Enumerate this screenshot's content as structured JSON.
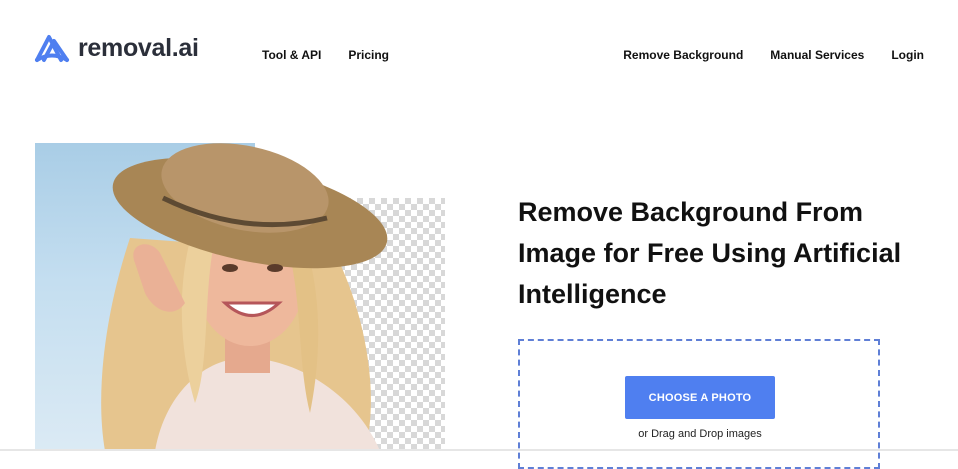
{
  "header": {
    "logo_text": "removal.ai",
    "nav_left": [
      {
        "label": "Tool & API"
      },
      {
        "label": "Pricing"
      }
    ],
    "nav_right": [
      {
        "label": "Remove Background"
      },
      {
        "label": "Manual Services"
      },
      {
        "label": "Login"
      }
    ]
  },
  "hero": {
    "headline": "Remove Background From Image for Free Using Artificial Intelligence",
    "upload": {
      "button_label": "CHOOSE A PHOTO",
      "drag_text": "or Drag and Drop images"
    }
  },
  "colors": {
    "brand_logo": "#4f7ff0",
    "button": "#4f7ff0",
    "dashed_border": "#5f7fd6"
  }
}
